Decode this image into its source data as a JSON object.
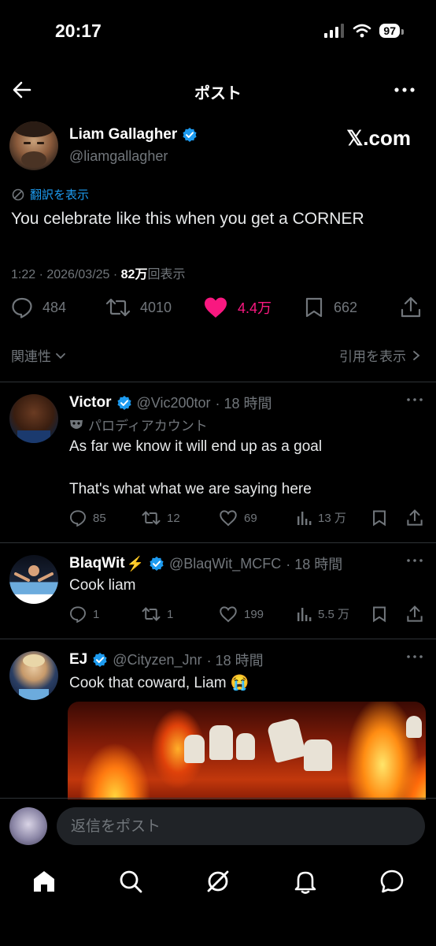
{
  "status": {
    "time": "20:17",
    "battery": "97"
  },
  "nav": {
    "title": "ポスト"
  },
  "post": {
    "author_name": "Liam Gallagher",
    "author_handle": "@liamgallagher",
    "source_logo": "𝕏.com",
    "translate_label": "翻訳を表示",
    "text": "You celebrate like this when you get a CORNER",
    "meta_time": "1:22 · 2026/03/25 · ",
    "meta_views": "82万",
    "meta_views_label": "回表示",
    "stats": {
      "replies": "484",
      "reposts": "4010",
      "likes": "4.4万",
      "bookmarks": "662"
    },
    "liked": true,
    "sort_label": "関連性",
    "quotes_label": "引用を表示"
  },
  "replies": [
    {
      "name": "Victor",
      "handle": "@Vic200tor",
      "time": "· 18 時間",
      "parody": "パロディアカウント",
      "text_lines": [
        "As far we know it will end up as a goal",
        "That's what what we are saying here"
      ],
      "stats": {
        "replies": "85",
        "reposts": "12",
        "likes": "69",
        "views": "13 万"
      }
    },
    {
      "name": "BlaqWit",
      "emoji": "⚡",
      "handle": "@BlaqWit_MCFC",
      "time": "· 18 時間",
      "text_lines": [
        "Cook liam"
      ],
      "stats": {
        "replies": "1",
        "reposts": "1",
        "likes": "199",
        "views": "5.5 万"
      }
    },
    {
      "name": "EJ",
      "handle": "@Cityzen_Jnr",
      "time": "· 18 時間",
      "text_lines": [
        "Cook that coward, Liam 😭"
      ]
    }
  ],
  "composer": {
    "placeholder": "返信をポスト"
  },
  "colors": {
    "accent": "#1d9bf0",
    "like": "#f91880",
    "muted": "#71767b",
    "background": "#000000"
  },
  "icons": [
    "back-arrow-icon",
    "more-icon",
    "verified-badge-icon",
    "translate-icon",
    "reply-icon",
    "repost-icon",
    "like-icon",
    "bookmark-icon",
    "share-icon",
    "views-icon",
    "home-icon",
    "search-icon",
    "grok-icon",
    "notifications-icon",
    "messages-icon"
  ]
}
